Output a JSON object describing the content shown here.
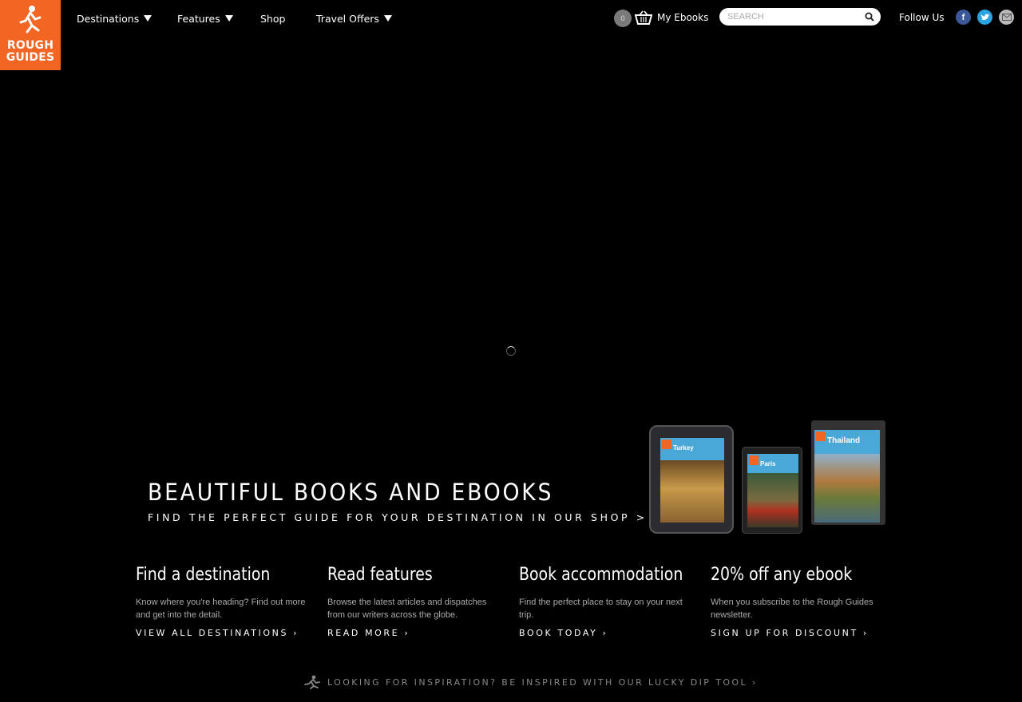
{
  "logo": {
    "line1": "ROUGH",
    "line2": "GUIDES"
  },
  "nav": {
    "destinations": "Destinations",
    "features": "Features",
    "shop": "Shop",
    "travel_offers": "Travel Offers"
  },
  "cart": {
    "count": "0",
    "my_ebooks": "My Ebooks"
  },
  "search": {
    "placeholder": "SEARCH"
  },
  "social": {
    "follow_label": "Follow Us"
  },
  "promo": {
    "title": "BEAUTIFUL BOOKS AND EBOOKS",
    "link": "FIND THE PERFECT GUIDE FOR YOUR DESTINATION IN OUR SHOP >",
    "covers": [
      "Turkey",
      "Paris",
      "Thailand"
    ]
  },
  "features": [
    {
      "title": "Find a destination",
      "text": "Know where you're heading? Find out more and get into the detail.",
      "link": "VIEW ALL DESTINATIONS ›"
    },
    {
      "title": "Read features",
      "text": "Browse the latest articles and dispatches from our writers across the globe.",
      "link": "READ MORE ›"
    },
    {
      "title": "Book accommodation",
      "text": "Find the perfect place to stay on your next trip.",
      "link": "BOOK TODAY ›"
    },
    {
      "title": "20% off any ebook",
      "text": "When you subscribe to the Rough Guides newsletter.",
      "link": "SIGN UP FOR DISCOUNT ›"
    }
  ],
  "lucky_dip": {
    "text": "LOOKING FOR INSPIRATION? BE INSPIRED WITH OUR LUCKY DIP TOOL ›"
  },
  "colors": {
    "brand": "#f26522",
    "background": "#000000"
  }
}
